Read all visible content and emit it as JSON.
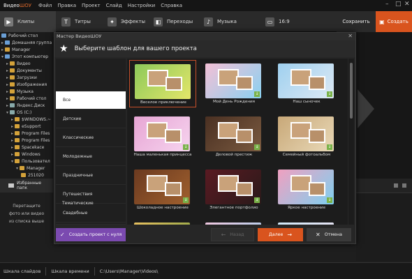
{
  "app": {
    "logo_prefix": "Видео",
    "logo_suffix": "ШОУ"
  },
  "menu": [
    "Файл",
    "Правка",
    "Проект",
    "Слайд",
    "Настройки",
    "Справка"
  ],
  "toolbar": {
    "tabs": [
      {
        "label": "Клипы",
        "icon": "play-icon"
      },
      {
        "label": "Титры",
        "icon": "text-icon"
      },
      {
        "label": "Эффекты",
        "icon": "effects-icon"
      },
      {
        "label": "Переходы",
        "icon": "transitions-icon"
      },
      {
        "label": "Музыка",
        "icon": "music-icon"
      },
      {
        "label": "16:9",
        "icon": "monitor-icon"
      }
    ],
    "save_label": "Сохранить",
    "create_label": "Создать"
  },
  "tree": [
    "Рабочий стол",
    "Домашняя группа",
    "Manager",
    "Этот компьютер",
    "Видео",
    "Документы",
    "Загрузки",
    "Изображения",
    "Музыка",
    "Рабочий стол",
    "Яндекс.Диск",
    "OS (C:)",
    "$WINDOWS.~",
    "eSupport",
    "Program Files",
    "Program Files",
    "Spacekace",
    "Windows",
    "Пользовател",
    "Manager",
    "251020",
    "25102"
  ],
  "favorites_label": "Избранные папк",
  "drop_hint": [
    "Перетащите",
    "фото или видео",
    "из списка выше"
  ],
  "status": {
    "slides_tab": "Шкала слайдов",
    "timeline_tab": "Шкала времени",
    "path": "C:\\Users\\Manager\\Videos\\"
  },
  "modal": {
    "window_title": "Мастер ВидеоШОУ",
    "heading": "Выберите шаблон для вашего проекта",
    "categories": [
      "Все",
      "Детские",
      "Классические",
      "Молодежные",
      "Праздничные",
      "Путешествия",
      "Свадебные",
      "Тематические"
    ],
    "active_category": "Все",
    "templates": [
      {
        "label": "Веселое приключение",
        "bg": "#8cc95a",
        "bg2": "#e4e66a",
        "selected": true
      },
      {
        "label": "Мой День Рождения",
        "bg": "#f3c0d6",
        "bg2": "#8ad1f0"
      },
      {
        "label": "Наш сыночек",
        "bg": "#9fd0ef",
        "bg2": "#dde9f4"
      },
      {
        "label": "Наша маленькая принцесса",
        "bg": "#e7a5d4",
        "bg2": "#f6d4ef"
      },
      {
        "label": "Деловой престиж",
        "bg": "#4a3022",
        "bg2": "#7a5a40"
      },
      {
        "label": "Семейный фотоальбом",
        "bg": "#c8a878",
        "bg2": "#e9d9b8"
      },
      {
        "label": "Шоколадное настроение",
        "bg": "#6b3a20",
        "bg2": "#a0602e"
      },
      {
        "label": "Элегантное портфолио",
        "bg": "#5a1a22",
        "bg2": "#2a1a1a"
      },
      {
        "label": "Яркое настроение",
        "bg": "#f0a0c0",
        "bg2": "#7ed0f0"
      },
      {
        "label": "",
        "bg": "#e7c060",
        "bg2": "#7aa040"
      },
      {
        "label": "",
        "bg": "#f0c8e0",
        "bg2": "#9fd0ef"
      },
      {
        "label": "",
        "bg": "#d0e8f8",
        "bg2": "#f0e0f0"
      }
    ],
    "btn_scratch": "Создать проект с нуля",
    "btn_back": "Назад",
    "btn_next": "Далее",
    "btn_cancel": "Отмена"
  }
}
